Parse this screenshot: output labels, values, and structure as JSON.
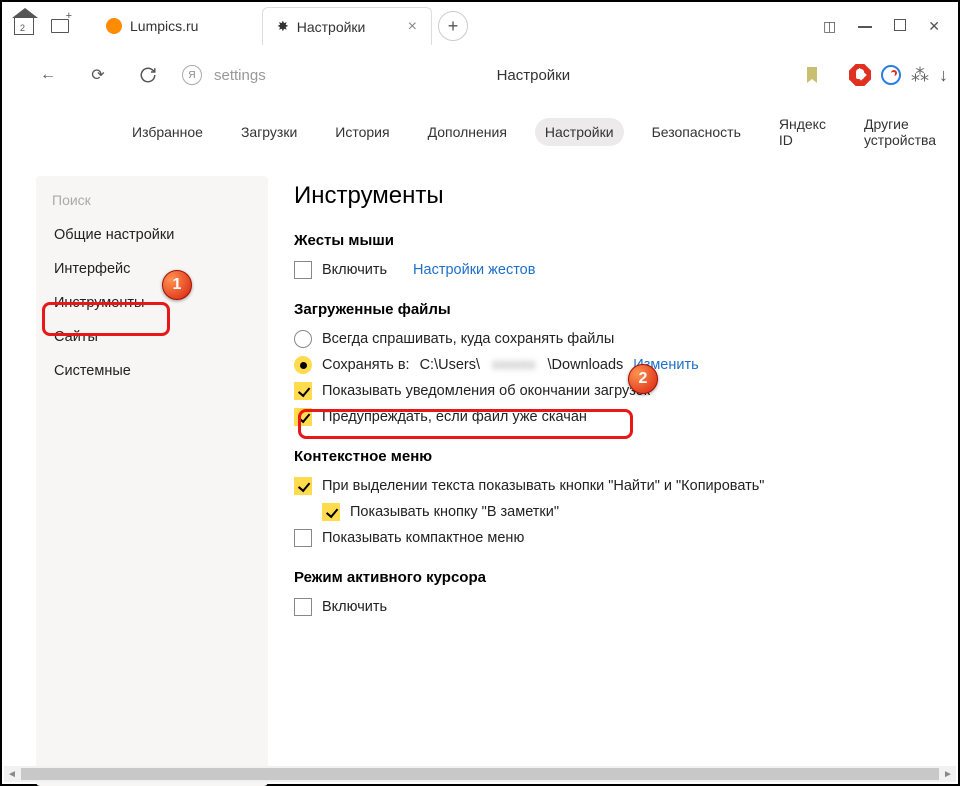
{
  "titlebar": {
    "home_badge": "2",
    "tab1_label": "Lumpics.ru",
    "tab2_label": "Настройки"
  },
  "addrbar": {
    "url_label": "settings",
    "title": "Настройки"
  },
  "topnav": {
    "fav": "Избранное",
    "dl": "Загрузки",
    "hist": "История",
    "ext": "Дополнения",
    "settings": "Настройки",
    "sec": "Безопасность",
    "yid": "Яндекс ID",
    "dev": "Другие устройства"
  },
  "sidebar": {
    "search": "Поиск",
    "items": [
      "Общие настройки",
      "Интерфейс",
      "Инструменты",
      "Сайты",
      "Системные"
    ]
  },
  "main": {
    "title": "Инструменты",
    "mouse": {
      "title": "Жесты мыши",
      "enable": "Включить",
      "link": "Настройки жестов"
    },
    "downloads": {
      "title": "Загруженные файлы",
      "ask": "Всегда спрашивать, куда сохранять файлы",
      "saveto_label": "Сохранять в:",
      "path1": "C:\\Users\\",
      "path_blur": "xxxxxx",
      "path2": "\\Downloads",
      "change": "Изменить",
      "notify": "Показывать уведомления об окончании загрузок",
      "warn": "Предупреждать, если файл уже скачан"
    },
    "ctx": {
      "title": "Контекстное меню",
      "findcopy": "При выделении текста показывать кнопки \"Найти\" и \"Копировать\"",
      "notes": "Показывать кнопку \"В заметки\"",
      "compact": "Показывать компактное меню"
    },
    "caret": {
      "title": "Режим активного курсора",
      "enable": "Включить"
    }
  }
}
